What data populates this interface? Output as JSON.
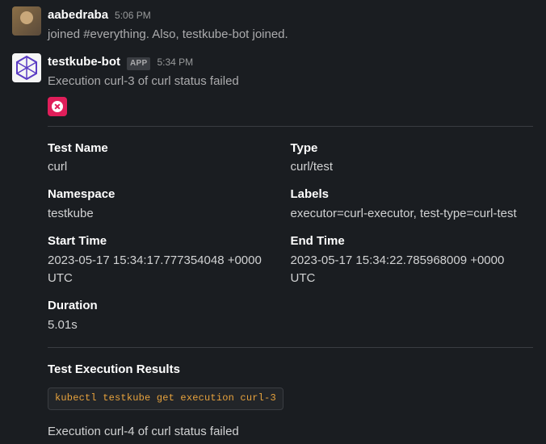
{
  "messages": [
    {
      "username": "aabedraba",
      "timestamp": "5:06 PM",
      "text": "joined #everything. Also, testkube-bot joined."
    },
    {
      "username": "testkube-bot",
      "app_badge": "APP",
      "timestamp": "5:34 PM",
      "text": "Execution curl-3 of curl status failed",
      "attachment": {
        "fields": {
          "test_name": {
            "label": "Test Name",
            "value": "curl"
          },
          "type": {
            "label": "Type",
            "value": "curl/test"
          },
          "namespace": {
            "label": "Namespace",
            "value": "testkube"
          },
          "labels": {
            "label": "Labels",
            "value": "executor=curl-executor, test-type=curl-test"
          },
          "start_time": {
            "label": "Start Time",
            "value": "2023-05-17 15:34:17.777354048 +0000 UTC"
          },
          "end_time": {
            "label": "End Time",
            "value": "2023-05-17 15:34:22.785968009 +0000 UTC"
          },
          "duration": {
            "label": "Duration",
            "value": "5.01s"
          }
        },
        "results_title": "Test Execution Results",
        "command": "kubectl testkube get execution curl-3"
      },
      "next_text": "Execution curl-4 of curl status failed"
    }
  ]
}
